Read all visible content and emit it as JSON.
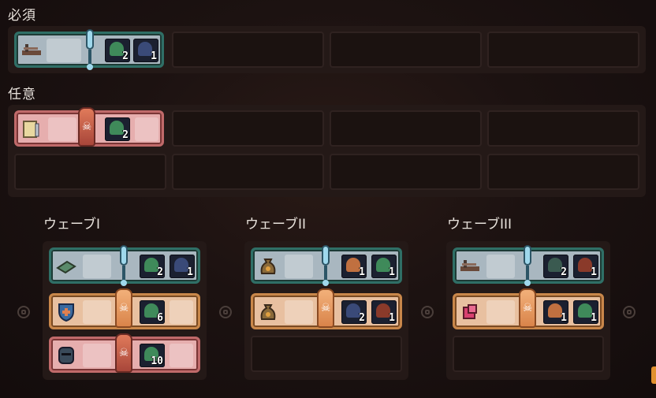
{
  "sections": {
    "required": "必須",
    "optional": "任意"
  },
  "waves": [
    {
      "label": "ウェーブI"
    },
    {
      "label": "ウェーブII"
    },
    {
      "label": "ウェーブIII"
    }
  ],
  "required_quest": {
    "icon": "crossbow-icon",
    "enemies": [
      {
        "icon": "green-goblin-icon",
        "count": "2"
      },
      {
        "icon": "dark-goblin-icon",
        "count": "1"
      }
    ]
  },
  "optional_quest": {
    "icon": "scroll-sword-icon",
    "enemies": [
      {
        "icon": "green-goblin-icon",
        "count": "2"
      }
    ]
  },
  "wave_quests": [
    [
      {
        "style": "teal",
        "icon": "book-icon",
        "marker": "pin",
        "enemies": [
          {
            "icon": "green-goblin-icon",
            "count": "2"
          },
          {
            "icon": "dark-goblin-icon",
            "count": "1"
          }
        ]
      },
      {
        "style": "orange",
        "icon": "shield-icon",
        "marker": "crest-orange",
        "enemies": [
          {
            "icon": "green-goblin-icon",
            "count": "6"
          }
        ]
      },
      {
        "style": "pink",
        "icon": "helmet-icon",
        "marker": "crest-red",
        "enemies": [
          {
            "icon": "green-goblin-icon",
            "count": "10"
          }
        ]
      }
    ],
    [
      {
        "style": "teal",
        "icon": "sack-icon",
        "marker": "pin",
        "enemies": [
          {
            "icon": "orc-icon",
            "count": "1"
          },
          {
            "icon": "green-goblin-icon",
            "count": "1"
          }
        ]
      },
      {
        "style": "orange",
        "icon": "sack-icon",
        "marker": "crest-orange",
        "enemies": [
          {
            "icon": "dark-goblin-icon",
            "count": "2"
          },
          {
            "icon": "hooded-icon",
            "count": "1"
          }
        ]
      }
    ],
    [
      {
        "style": "teal",
        "icon": "crossbow-icon",
        "marker": "pin",
        "enemies": [
          {
            "icon": "dark-goblin-icon",
            "count": "2"
          },
          {
            "icon": "hooded-icon",
            "count": "1"
          }
        ]
      },
      {
        "style": "orange",
        "icon": "gem-stack-icon",
        "marker": "crest-orange",
        "enemies": [
          {
            "icon": "orc-icon",
            "count": "1"
          },
          {
            "icon": "green-goblin-icon",
            "count": "1"
          }
        ]
      }
    ]
  ],
  "colors": {
    "teal": "#2f6f66",
    "pink": "#c06a6a",
    "orange": "#c9874a",
    "goblin": "#3f8a5a",
    "dark_goblin": "#3a4a78",
    "orc": "#c07040",
    "hooded": "#8a3a2a"
  }
}
